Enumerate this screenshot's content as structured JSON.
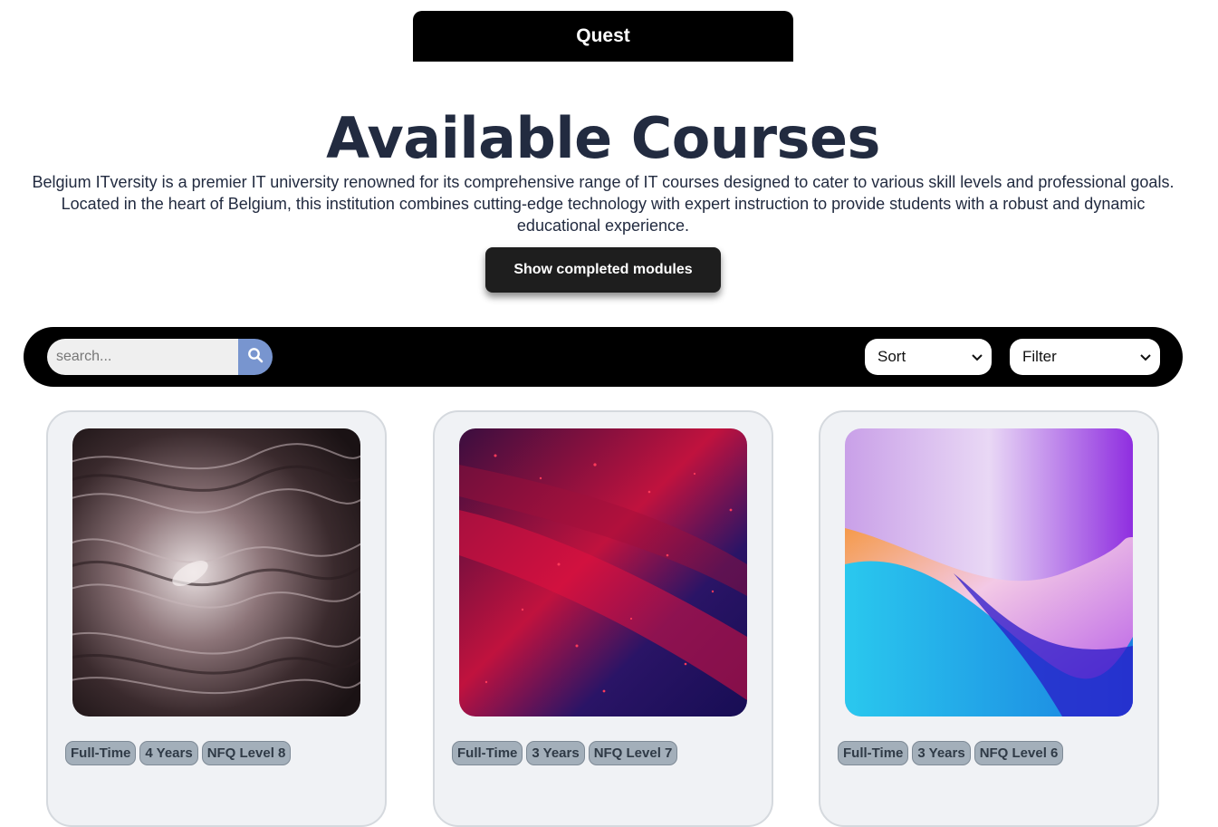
{
  "header": {
    "title": "Quest"
  },
  "main": {
    "title": "Available Courses",
    "intro": "Belgium ITversity is a premier IT university renowned for its comprehensive range of IT courses designed to cater to various skill levels and professional goals. Located in the heart of Belgium, this institution combines cutting-edge technology with expert instruction to provide students with a robust and dynamic educational experience.",
    "show_completed_label": "Show completed modules"
  },
  "toolbar": {
    "search_placeholder": "search...",
    "sort_label": "Sort",
    "filter_label": "Filter",
    "accent": "#7895cf"
  },
  "courses": [
    {
      "tags": [
        "Full-Time",
        "4 Years",
        "NFQ Level 8"
      ],
      "image": "marble-swirl"
    },
    {
      "tags": [
        "Full-Time",
        "3 Years",
        "NFQ Level 7"
      ],
      "image": "red-particle-galaxy"
    },
    {
      "tags": [
        "Full-Time",
        "3 Years",
        "NFQ Level 6"
      ],
      "image": "gradient-waves"
    }
  ]
}
